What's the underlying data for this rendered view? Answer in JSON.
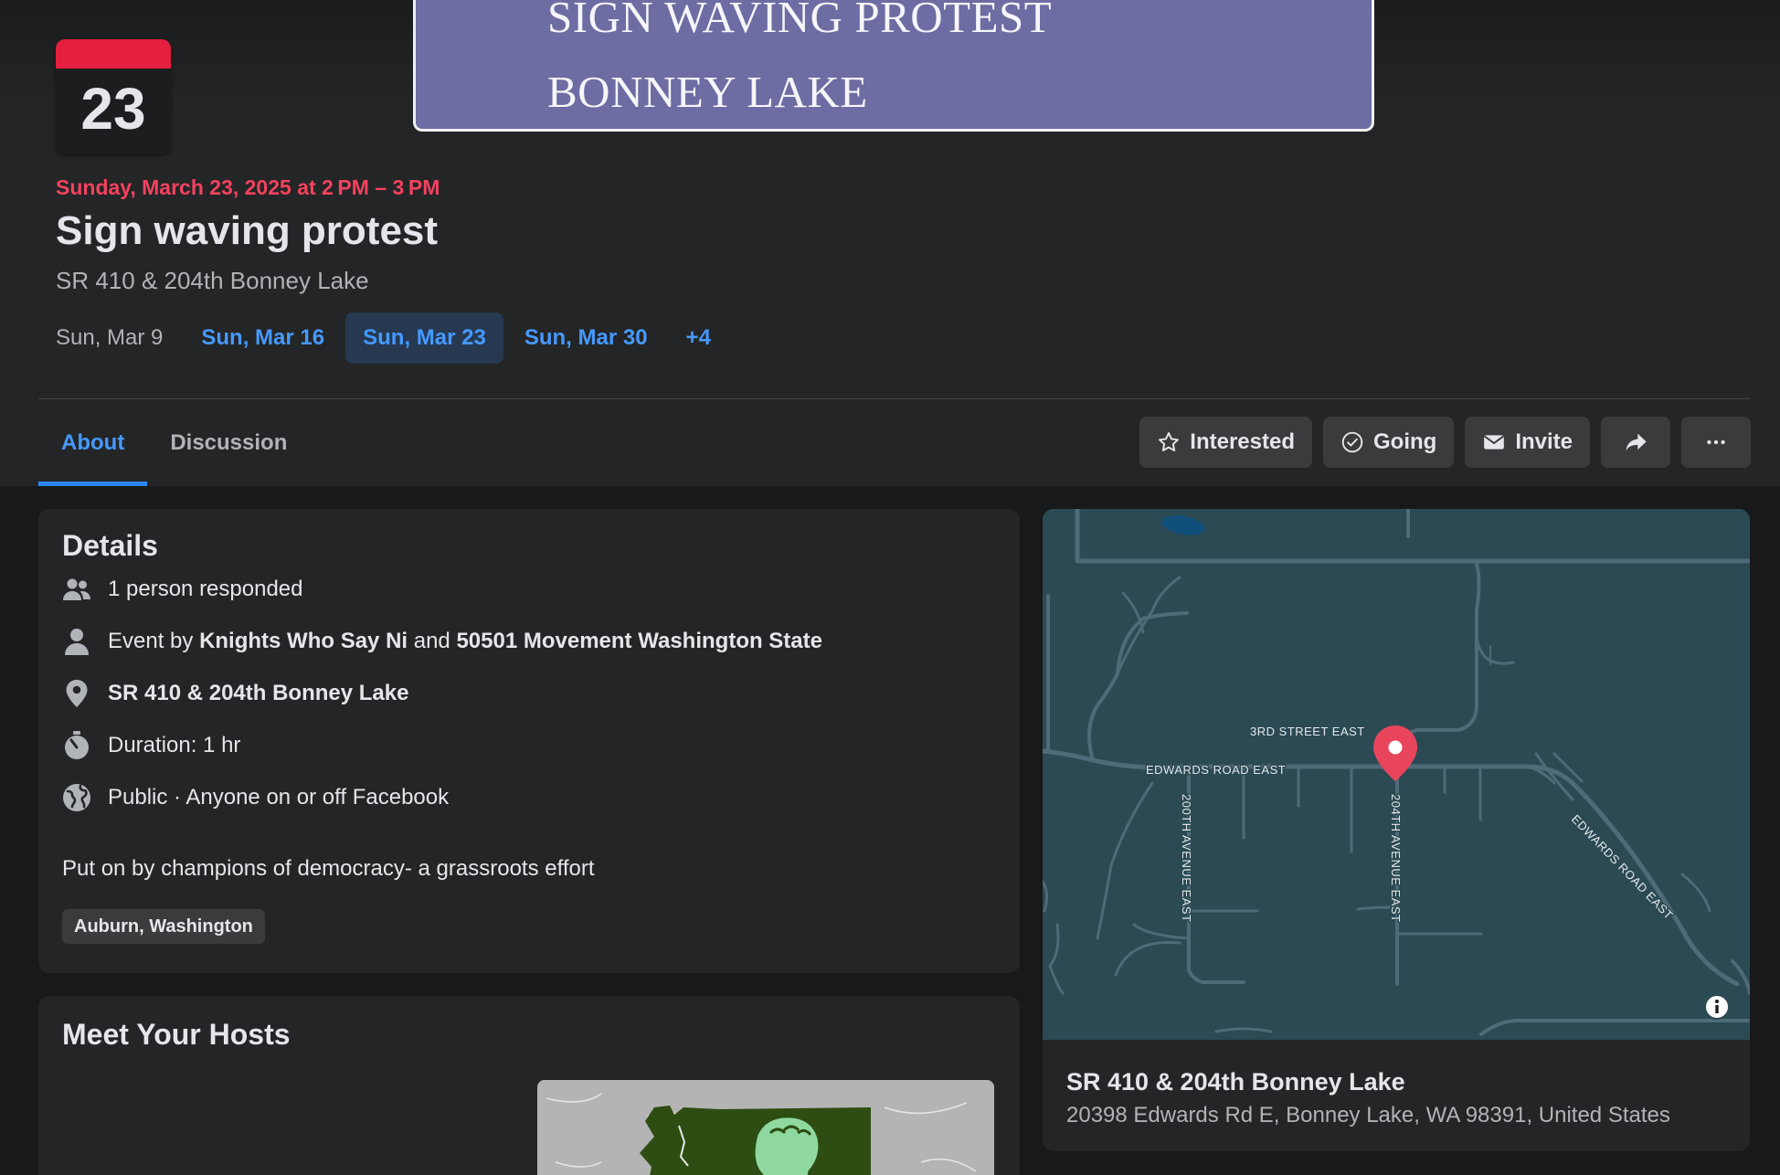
{
  "cover": {
    "line1": "SIGN WAVING PROTEST",
    "line2": "BONNEY LAKE",
    "bg_color": "#6d6ca3"
  },
  "date_card": {
    "day": "23"
  },
  "event": {
    "when": "Sunday, March 23, 2025 at 2 PM – 3 PM",
    "title": "Sign waving protest",
    "location": "SR 410 & 204th Bonney Lake"
  },
  "dates": [
    {
      "label": "Sun, Mar 9",
      "state": "past"
    },
    {
      "label": "Sun, Mar 16",
      "state": "upcoming"
    },
    {
      "label": "Sun, Mar 23",
      "state": "selected"
    },
    {
      "label": "Sun, Mar 30",
      "state": "upcoming"
    },
    {
      "label": "+4",
      "state": "more"
    }
  ],
  "tabs": [
    {
      "label": "About",
      "active": true
    },
    {
      "label": "Discussion",
      "active": false
    }
  ],
  "actions": {
    "interested": "Interested",
    "going": "Going",
    "invite": "Invite",
    "share_icon": "share-icon",
    "more_icon": "more-icon"
  },
  "details": {
    "heading": "Details",
    "responded": "1 person responded",
    "event_by_prefix": "Event by",
    "host1": "Knights Who Say Ni",
    "and": "and",
    "host2": "50501 Movement Washington State",
    "location": "SR 410 & 204th Bonney Lake",
    "duration": "Duration: 1 hr",
    "privacy": "Public · Anyone on or off Facebook",
    "description": "Put on by champions of democracy- a grassroots effort",
    "tag": "Auburn, Washington"
  },
  "hosts": {
    "heading": "Meet Your Hosts"
  },
  "map": {
    "streets": [
      "3RD STREET EAST",
      "EDWARDS ROAD EAST",
      "200TH AVENUE EAST",
      "204TH AVENUE EAST",
      "EDWARDS ROAD EAST"
    ],
    "venue_name": "SR 410 & 204th Bonney Lake",
    "address": "20398 Edwards Rd E, Bonney Lake, WA 98391, United States"
  },
  "colors": {
    "accent": "#2d88ff",
    "link": "#4599ff",
    "date_red": "#f3425f",
    "card": "#242526",
    "pin": "#e8455c"
  }
}
